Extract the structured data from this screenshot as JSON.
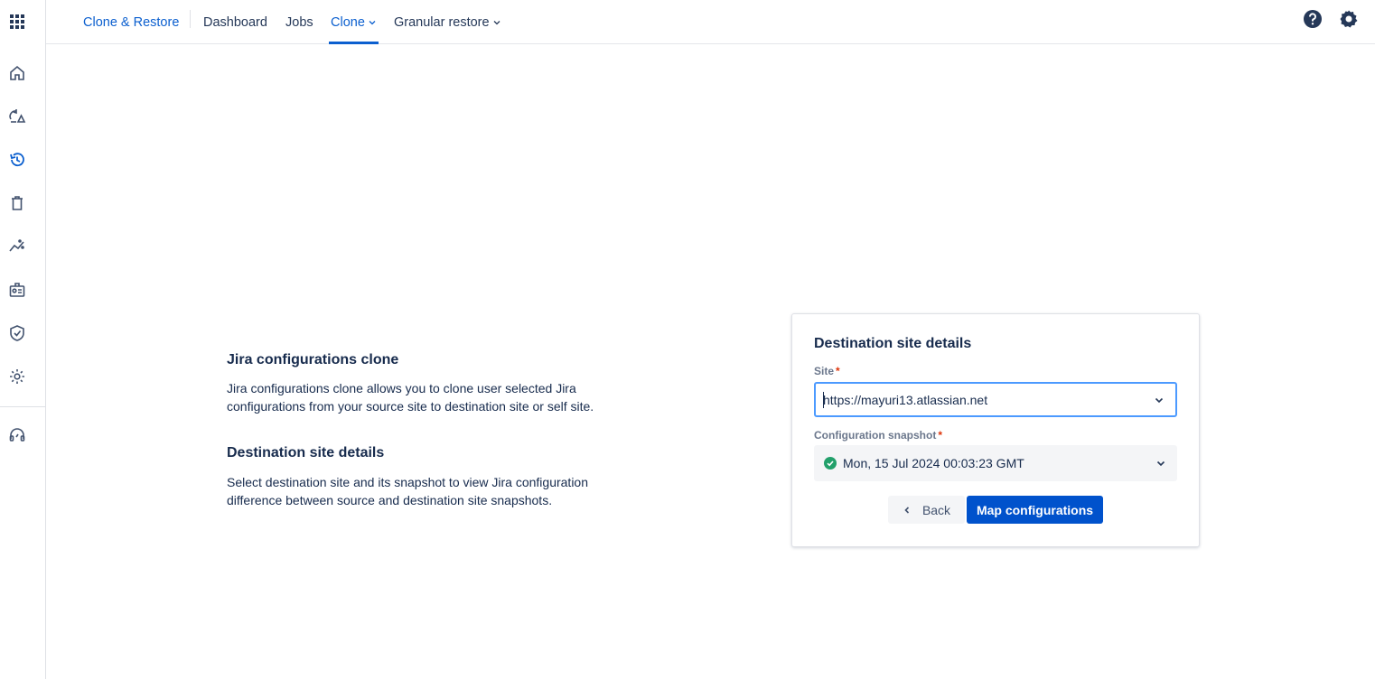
{
  "topnav": {
    "brand": "Clone & Restore",
    "items": [
      {
        "label": "Dashboard"
      },
      {
        "label": "Jobs"
      },
      {
        "label": "Clone"
      },
      {
        "label": "Granular restore"
      }
    ]
  },
  "sidebar": {
    "icons": [
      "app-grid-icon",
      "home-icon",
      "backup-restore-icon",
      "history-icon",
      "trash-icon",
      "analytics-icon",
      "id-card-icon",
      "shield-check-icon",
      "settings-icon",
      "support-icon"
    ]
  },
  "intro": {
    "title": "Jira configurations clone",
    "description": "Jira configurations clone allows you to clone user selected Jira configurations from your source site to destination site or self site.",
    "subtitle": "Destination site details",
    "subdescription": "Select destination site and its snapshot to view Jira configuration difference between source and destination site snapshots."
  },
  "card": {
    "title": "Destination site details",
    "site_label": "Site",
    "site_value": "https://mayuri13.atlassian.net",
    "snapshot_label": "Configuration snapshot",
    "snapshot_value": "Mon, 15 Jul 2024 00:03:23 GMT",
    "required_mark": "*",
    "back_label": "Back",
    "map_label": "Map configurations"
  },
  "colors": {
    "accent": "#0b5fcf",
    "primary_button": "#0052cc",
    "success": "#22a06b",
    "required": "#de350b"
  }
}
